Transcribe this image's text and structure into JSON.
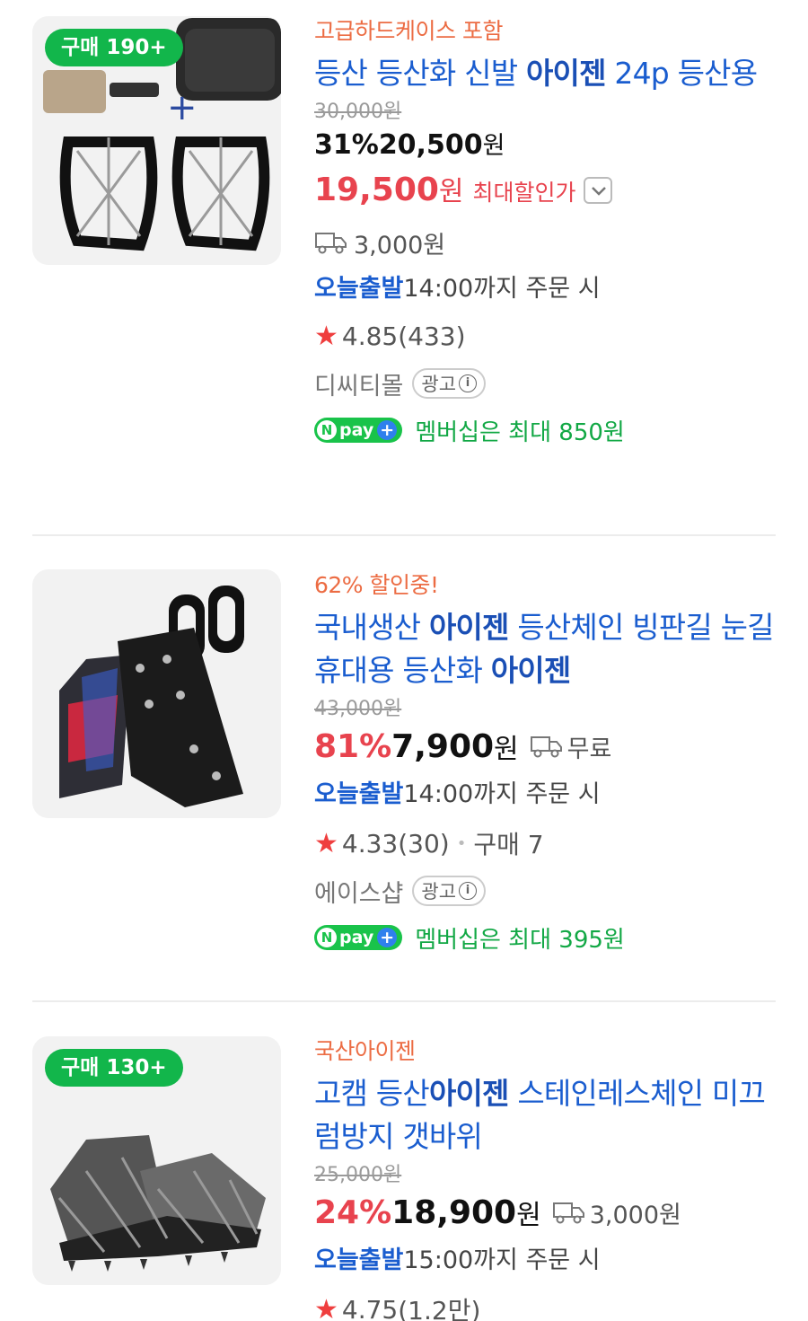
{
  "products": [
    {
      "buy_badge": "구매 190+",
      "promo": "고급하드케이스 포함",
      "title_parts": [
        "등산 등산화 신발 ",
        "아이젠",
        " 24p 등산용"
      ],
      "original_price": "30,000원",
      "discount_rate": "31%",
      "price": "20,500",
      "won": "원",
      "max_discount_price": "19,500",
      "max_discount_won": "원",
      "max_discount_label": "최대할인가",
      "shipping": "3,000원",
      "today_label": "오늘출발",
      "today_text": "14:00까지 주문 시",
      "rating": "4.85",
      "reviews": "(433)",
      "seller": "디씨티몰",
      "ad_label": "광고",
      "npay_text": "멤버십은 최대 850원"
    },
    {
      "promo": "62% 할인중!",
      "title_parts": [
        "국내생산 ",
        "아이젠",
        " 등산체인 빙판길 눈길 휴대용 등산화 ",
        "아이젠"
      ],
      "original_price": "43,000원",
      "discount_rate": "81%",
      "price": "7,900",
      "won": "원",
      "shipping": "무료",
      "today_label": "오늘출발",
      "today_text": "14:00까지 주문 시",
      "rating": "4.33",
      "reviews": "(30)",
      "purchases": "구매 7",
      "seller": "에이스샵",
      "ad_label": "광고",
      "npay_text": "멤버십은 최대 395원"
    },
    {
      "buy_badge": "구매 130+",
      "promo": "국산아이젠",
      "title_parts": [
        "고캠 등산",
        "아이젠",
        " 스테인레스체인 미끄럼방지 갯바위"
      ],
      "original_price": "25,000원",
      "discount_rate": "24%",
      "price": "18,900",
      "won": "원",
      "shipping": "3,000원",
      "today_label": "오늘출발",
      "today_text": "15:00까지 주문 시",
      "rating": "4.75",
      "reviews": "(1.2만)"
    }
  ],
  "npay_brand": "pay",
  "icons": {
    "truck": "truck-icon",
    "star": "star-icon",
    "chevron": "chevron-down-icon",
    "info": "info-icon"
  },
  "colors": {
    "discount_red": "#e8434e",
    "title_blue": "#1a5dcf",
    "badge_green": "#12b64b",
    "promo_orange": "#ec6c43",
    "npay_green": "#12a845"
  }
}
